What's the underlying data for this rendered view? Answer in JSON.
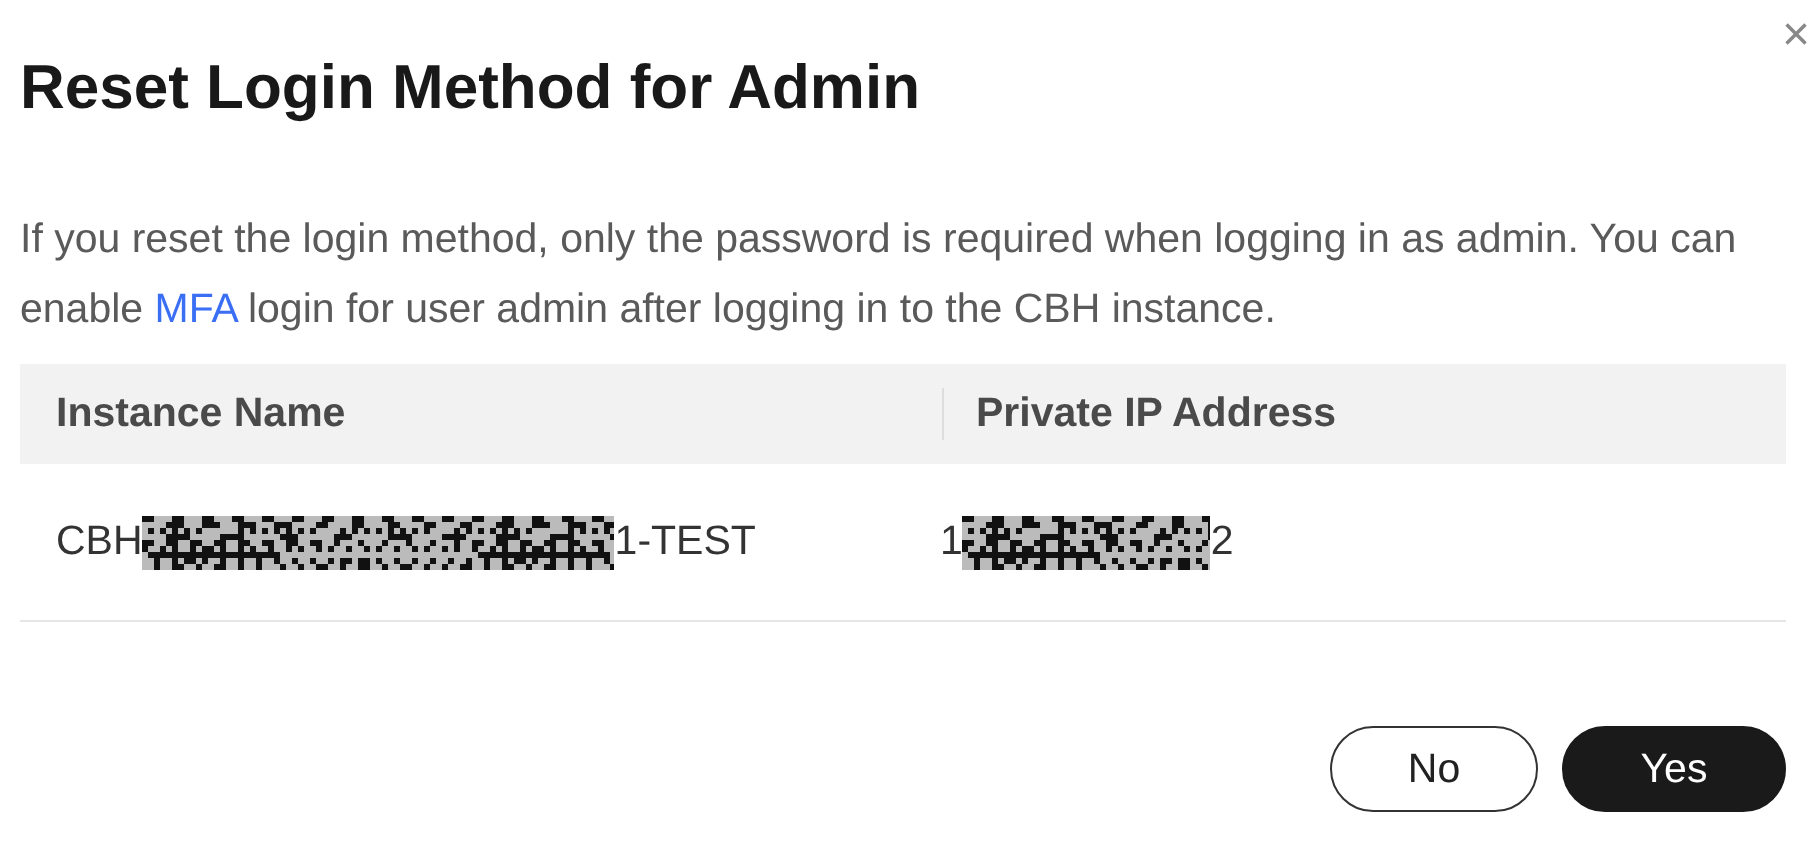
{
  "dialog": {
    "title": "Reset Login Method for Admin",
    "close": "×",
    "message_parts": [
      "If you reset the login method, only the password is required when logging in as admin. You can enable ",
      "MFA",
      " login for user admin after logging in to the CBH instance."
    ],
    "table": {
      "columns": [
        "Instance Name",
        "Private IP Address"
      ],
      "rows": [
        {
          "cells": [
            {
              "before": "CBH",
              "after": "1-TEST",
              "redacted": true
            },
            {
              "before": "1",
              "after": "2",
              "redacted": true
            }
          ]
        }
      ]
    },
    "buttons": [
      {
        "label": "No",
        "kind": "secondary"
      },
      {
        "label": "Yes",
        "kind": "primary"
      }
    ]
  }
}
